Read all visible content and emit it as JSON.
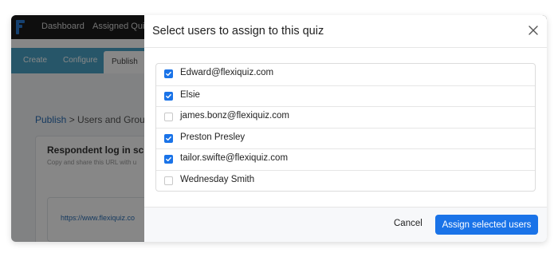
{
  "app": {
    "nav": [
      "Dashboard",
      "Assigned Quizz"
    ],
    "subtabs": [
      "Create",
      "Configure",
      "Publish"
    ],
    "active_subtab": "Publish",
    "breadcrumb": {
      "link": "Publish",
      "separator": " > ",
      "current": "Users and Groups"
    },
    "card": {
      "title": "Respondent log in scre",
      "subtitle": "Copy and share this URL with u",
      "url": "https://www.flexiquiz.co"
    }
  },
  "modal": {
    "title": "Select users to assign to this quiz",
    "users": [
      {
        "label": "Edward@flexiquiz.com",
        "checked": true
      },
      {
        "label": "Elsie",
        "checked": true
      },
      {
        "label": "james.bonz@flexiquiz.com",
        "checked": false
      },
      {
        "label": "Preston Presley",
        "checked": true
      },
      {
        "label": "tailor.swifte@flexiquiz.com",
        "checked": true
      },
      {
        "label": "Wednesday Smith",
        "checked": false
      }
    ],
    "cancel_label": "Cancel",
    "assign_label": "Assign selected users"
  },
  "colors": {
    "accent": "#1a73e8",
    "subnav": "#4aa3c7",
    "topbar": "#1c1c1c"
  }
}
